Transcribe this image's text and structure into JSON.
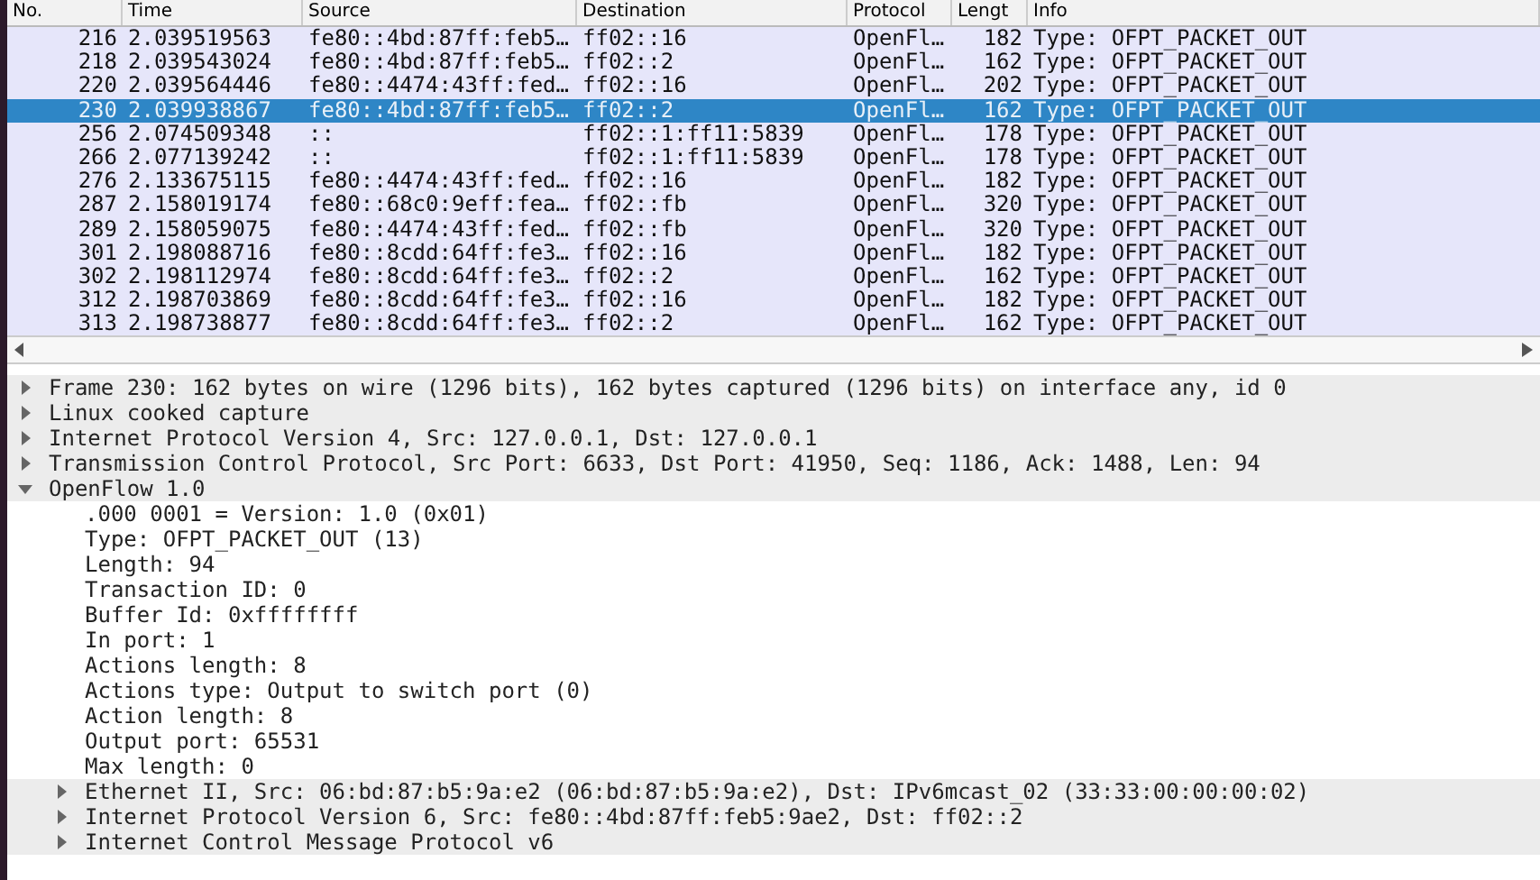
{
  "packet_list": {
    "columns": [
      "No.",
      "Time",
      "Source",
      "Destination",
      "Protocol",
      "Lengt",
      "Info"
    ],
    "rows": [
      {
        "no": "216",
        "time": "2.039519563",
        "source": "fe80::4bd:87ff:feb5…",
        "destination": "ff02::16",
        "protocol": "OpenFl…",
        "length": "182",
        "info": "Type: OFPT_PACKET_OUT",
        "selected": false
      },
      {
        "no": "218",
        "time": "2.039543024",
        "source": "fe80::4bd:87ff:feb5…",
        "destination": "ff02::2",
        "protocol": "OpenFl…",
        "length": "162",
        "info": "Type: OFPT_PACKET_OUT",
        "selected": false
      },
      {
        "no": "220",
        "time": "2.039564446",
        "source": "fe80::4474:43ff:fed…",
        "destination": "ff02::16",
        "protocol": "OpenFl…",
        "length": "202",
        "info": "Type: OFPT_PACKET_OUT",
        "selected": false
      },
      {
        "no": "230",
        "time": "2.039938867",
        "source": "fe80::4bd:87ff:feb5…",
        "destination": "ff02::2",
        "protocol": "OpenFl…",
        "length": "162",
        "info": "Type: OFPT_PACKET_OUT",
        "selected": true
      },
      {
        "no": "256",
        "time": "2.074509348",
        "source": "::",
        "destination": "ff02::1:ff11:5839",
        "protocol": "OpenFl…",
        "length": "178",
        "info": "Type: OFPT_PACKET_OUT",
        "selected": false
      },
      {
        "no": "266",
        "time": "2.077139242",
        "source": "::",
        "destination": "ff02::1:ff11:5839",
        "protocol": "OpenFl…",
        "length": "178",
        "info": "Type: OFPT_PACKET_OUT",
        "selected": false
      },
      {
        "no": "276",
        "time": "2.133675115",
        "source": "fe80::4474:43ff:fed…",
        "destination": "ff02::16",
        "protocol": "OpenFl…",
        "length": "182",
        "info": "Type: OFPT_PACKET_OUT",
        "selected": false
      },
      {
        "no": "287",
        "time": "2.158019174",
        "source": "fe80::68c0:9eff:fea…",
        "destination": "ff02::fb",
        "protocol": "OpenFl…",
        "length": "320",
        "info": "Type: OFPT_PACKET_OUT",
        "selected": false
      },
      {
        "no": "289",
        "time": "2.158059075",
        "source": "fe80::4474:43ff:fed…",
        "destination": "ff02::fb",
        "protocol": "OpenFl…",
        "length": "320",
        "info": "Type: OFPT_PACKET_OUT",
        "selected": false
      },
      {
        "no": "301",
        "time": "2.198088716",
        "source": "fe80::8cdd:64ff:fe3…",
        "destination": "ff02::16",
        "protocol": "OpenFl…",
        "length": "182",
        "info": "Type: OFPT_PACKET_OUT",
        "selected": false
      },
      {
        "no": "302",
        "time": "2.198112974",
        "source": "fe80::8cdd:64ff:fe3…",
        "destination": "ff02::2",
        "protocol": "OpenFl…",
        "length": "162",
        "info": "Type: OFPT_PACKET_OUT",
        "selected": false
      },
      {
        "no": "312",
        "time": "2.198703869",
        "source": "fe80::8cdd:64ff:fe3…",
        "destination": "ff02::16",
        "protocol": "OpenFl…",
        "length": "182",
        "info": "Type: OFPT_PACKET_OUT",
        "selected": false
      },
      {
        "no": "313",
        "time": "2.198738877",
        "source": "fe80::8cdd:64ff:fe3…",
        "destination": "ff02::2",
        "protocol": "OpenFl…",
        "length": "162",
        "info": "Type: OFPT_PACKET_OUT",
        "selected": false
      }
    ]
  },
  "packet_details": [
    {
      "label": "Frame 230: 162 bytes on wire (1296 bits), 162 bytes captured (1296 bits) on interface any, id 0",
      "expanded": false
    },
    {
      "label": "Linux cooked capture",
      "expanded": false
    },
    {
      "label": "Internet Protocol Version 4, Src: 127.0.0.1, Dst: 127.0.0.1",
      "expanded": false
    },
    {
      "label": "Transmission Control Protocol, Src Port: 6633, Dst Port: 41950, Seq: 1186, Ack: 1488, Len: 94",
      "expanded": false
    },
    {
      "label": "OpenFlow 1.0",
      "expanded": true,
      "children": [
        {
          "label": ".000 0001 = Version: 1.0 (0x01)"
        },
        {
          "label": "Type: OFPT_PACKET_OUT (13)"
        },
        {
          "label": "Length: 94"
        },
        {
          "label": "Transaction ID: 0"
        },
        {
          "label": "Buffer Id: 0xffffffff"
        },
        {
          "label": "In port: 1"
        },
        {
          "label": "Actions length: 8"
        },
        {
          "label": "Actions type: Output to switch port (0)"
        },
        {
          "label": "Action length: 8"
        },
        {
          "label": "Output port: 65531"
        },
        {
          "label": "Max length: 0"
        },
        {
          "label": "Ethernet II, Src: 06:bd:87:b5:9a:e2 (06:bd:87:b5:9a:e2), Dst: IPv6mcast_02 (33:33:00:00:00:02)",
          "expanded": false
        },
        {
          "label": "Internet Protocol Version 6, Src: fe80::4bd:87ff:feb5:9ae2, Dst: ff02::2",
          "expanded": false
        },
        {
          "label": "Internet Control Message Protocol v6",
          "expanded": false
        }
      ]
    }
  ]
}
